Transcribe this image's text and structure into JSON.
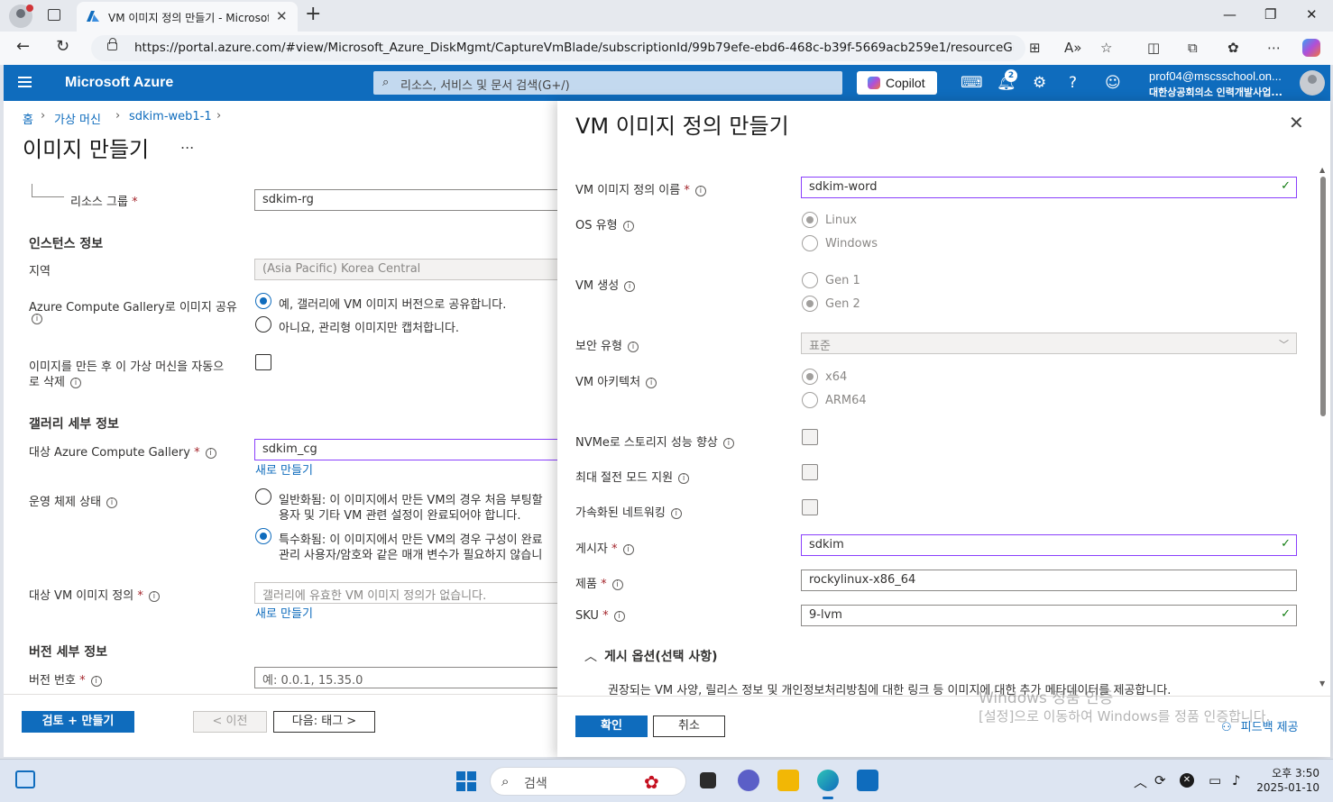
{
  "browser": {
    "tab_title": "VM 이미지 정의 만들기 - Microsoft Azure",
    "url": "https://portal.azure.com/#view/Microsoft_Azure_DiskMgmt/CaptureVmBlade/subscriptionId/99b79efe-ebd6-468c-b39f-5669acb259e1/resourceGroup/SDKI..."
  },
  "azure_header": {
    "brand": "Microsoft Azure",
    "search_placeholder": "리소스, 서비스 및 문서 검색(G+/)",
    "copilot_label": "Copilot",
    "notification_count": "2",
    "user_email": "prof04@mscsschool.on...",
    "user_org": "대한상공회의소 인력개발사업..."
  },
  "page": {
    "breadcrumb": [
      "홈",
      "가상 머신",
      "sdkim-web1-1"
    ],
    "title": "이미지 만들기",
    "more": "...",
    "resource_group_label": "리소스 그룹",
    "resource_group_value": "sdkim-rg",
    "instance_section": "인스턴스 정보",
    "region_label": "지역",
    "region_value": "(Asia Pacific) Korea Central",
    "share_label": "Azure Compute Gallery로 이미지 공유",
    "share_yes": "예, 갤러리에 VM 이미지 버전으로 공유합니다.",
    "share_no": "아니요, 관리형 이미지만 캡처합니다.",
    "autodelete_label_1": "이미지를 만든 후 이 가상 머신을 자동으",
    "autodelete_label_2": "로 삭제",
    "gallery_section": "갤러리 세부 정보",
    "target_gallery_label": "대상 Azure Compute Gallery",
    "target_gallery_value": "sdkim_cg",
    "create_new": "새로 만들기",
    "os_state_label": "운영 체제 상태",
    "generalized_1": "일반화됨: 이 이미지에서 만든 VM의 경우 처음 부팅할",
    "generalized_2": "용자 및 기타 VM 관련 설정이 완료되어야 합니다.",
    "specialized_1": "특수화됨: 이 이미지에서 만든 VM의 경우 구성이 완료",
    "specialized_2": "관리 사용자/암호와 같은 매개 변수가 필요하지 않습니",
    "target_def_label": "대상 VM 이미지 정의",
    "target_def_value": "갤러리에 유효한 VM 이미지 정의가 없습니다.",
    "create_new_2": "새로 만들기",
    "version_section": "버전 세부 정보",
    "version_label": "버전 번호",
    "version_placeholder": "예: 0.0.1, 15.35.0",
    "review_button": "검토 + 만들기",
    "prev_button": "< 이전",
    "next_button": "다음: 태그 >"
  },
  "blade": {
    "title": "VM 이미지 정의 만들기",
    "def_name_label": "VM 이미지 정의 이름",
    "def_name_value": "sdkim-word",
    "os_type_label": "OS 유형",
    "os_linux": "Linux",
    "os_windows": "Windows",
    "vm_gen_label": "VM 생성",
    "gen1": "Gen 1",
    "gen2": "Gen 2",
    "security_label": "보안 유형",
    "security_value": "표준",
    "arch_label": "VM 아키텍처",
    "arch_x64": "x64",
    "arch_arm64": "ARM64",
    "nvme_label": "NVMe로 스토리지 성능 향상",
    "hibernate_label": "최대 절전 모드 지원",
    "accel_label": "가속화된 네트워킹",
    "publisher_label": "게시자",
    "publisher_value": "sdkim",
    "product_label": "제품",
    "product_value": "rockylinux-x86_64",
    "sku_label": "SKU",
    "sku_value": "9-lvm",
    "publish_options": "게시 옵션(선택 사항)",
    "publish_desc": "권장되는 VM 사양, 릴리스 정보 및 개인정보처리방침에 대한 링크 등 이미지에 대한 추가 메타데이터를 제공합니다.",
    "ok_button": "확인",
    "cancel_button": "취소",
    "watermark_1": "Windows 정품 인증",
    "watermark_2": "[설정]으로 이동하여 Windows를 정품 인증합니다.",
    "feedback": "피드백 제공"
  },
  "taskbar": {
    "search_placeholder": "검색",
    "time": "오후 3:50",
    "date": "2025-01-10"
  }
}
